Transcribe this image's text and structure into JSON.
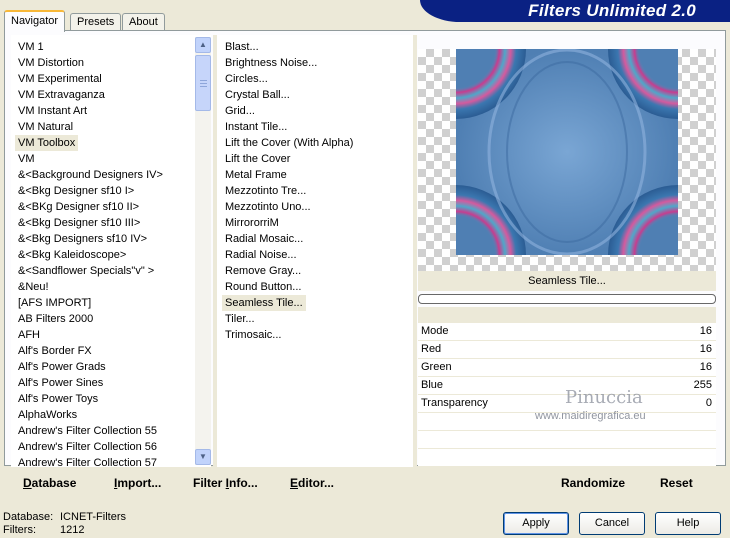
{
  "tabs": [
    {
      "label": "Navigator",
      "active": true
    },
    {
      "label": "Presets",
      "active": false
    },
    {
      "label": "About",
      "active": false
    }
  ],
  "banner": {
    "title": "Filters Unlimited 2.0"
  },
  "categories": {
    "selected_index": 6,
    "items": [
      "VM 1",
      "VM Distortion",
      "VM Experimental",
      "VM Extravaganza",
      "VM Instant Art",
      "VM Natural",
      "VM Toolbox",
      "VM",
      "&<Background Designers IV>",
      "&<Bkg Designer sf10 I>",
      "&<BKg Designer sf10 II>",
      "&<Bkg Designer sf10 III>",
      "&<Bkg Designers sf10 IV>",
      "&<Bkg Kaleidoscope>",
      "&<Sandflower Specials\"v\" >",
      "&Neu!",
      "[AFS IMPORT]",
      "AB Filters 2000",
      "AFH",
      "Alf's Border FX",
      "Alf's Power Grads",
      "Alf's Power Sines",
      "Alf's Power Toys",
      "AlphaWorks",
      "Andrew's Filter Collection 55",
      "Andrew's Filter Collection 56",
      "Andrew's Filter Collection 57"
    ]
  },
  "filters": {
    "selected_index": 16,
    "items": [
      "Blast...",
      "Brightness Noise...",
      "Circles...",
      "Crystal Ball...",
      "Grid...",
      "Instant Tile...",
      "Lift the Cover (With Alpha)",
      "Lift the Cover",
      "Metal Frame",
      "Mezzotinto Tre...",
      "Mezzotinto Uno...",
      "MirrororriM",
      "Radial Mosaic...",
      "Radial Noise...",
      "Remove Gray...",
      "Round Button...",
      "Seamless Tile...",
      "Tiler...",
      "Trimosaic..."
    ]
  },
  "preview": {
    "filter_name": "Seamless Tile..."
  },
  "params": [
    {
      "label": "Mode",
      "value": "16"
    },
    {
      "label": "Red",
      "value": "16"
    },
    {
      "label": "Green",
      "value": "16"
    },
    {
      "label": "Blue",
      "value": "255"
    },
    {
      "label": "Transparency",
      "value": "0"
    }
  ],
  "watermark": {
    "name": "Pinuccia",
    "url": "www.maidiregrafica.eu"
  },
  "links": {
    "database": "Database",
    "import": "Import...",
    "filter_info": "Filter Info...",
    "editor": "Editor...",
    "randomize": "Randomize",
    "reset": "Reset"
  },
  "status": {
    "database_label": "Database:",
    "database_value": "ICNET-Filters",
    "filters_label": "Filters:",
    "filters_value": "1212"
  },
  "buttons": {
    "apply": "Apply",
    "cancel": "Cancel",
    "help": "Help"
  },
  "colors": {
    "banner": "#0a2183",
    "tab_highlight": "#f8b838",
    "dialog_bg": "#ece9d8"
  }
}
